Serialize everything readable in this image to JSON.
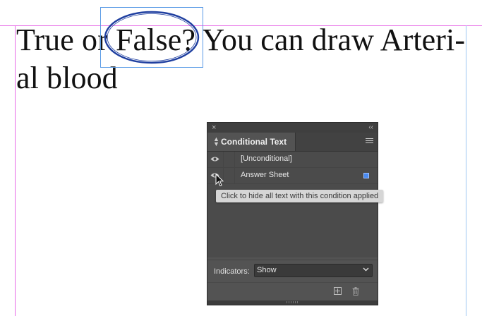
{
  "document": {
    "line1": "True or False? You can draw Arteri-",
    "line2": "al blood"
  },
  "panel": {
    "close_glyph": "×",
    "collapse_glyph": "‹‹",
    "tab_label": "Conditional Text",
    "tab_arrows_icon": "updown-arrows-icon",
    "menu_icon": "panel-menu-icon",
    "conditions": [
      {
        "label": "[Unconditional]",
        "visible": true,
        "swatch": null
      },
      {
        "label": "Answer Sheet",
        "visible": true,
        "swatch": "#4a8bf2"
      }
    ],
    "indicators_label": "Indicators:",
    "indicators_value": "Show",
    "new_condition_icon": "new-condition-icon",
    "delete_condition_icon": "trash-icon"
  },
  "tooltip": {
    "text": "Click to hide all text with this condition applied"
  },
  "colors": {
    "accent": "#4a8bf2",
    "panel_bg": "#535353",
    "oval_stroke": "#1f3fa0"
  }
}
